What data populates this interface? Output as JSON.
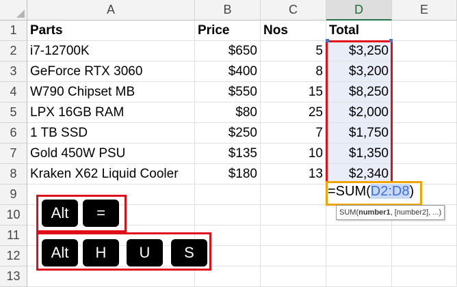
{
  "columns": [
    "A",
    "B",
    "C",
    "D",
    "E"
  ],
  "rows": [
    "1",
    "2",
    "3",
    "4",
    "5",
    "6",
    "7",
    "8",
    "9",
    "10",
    "11",
    "12",
    "13"
  ],
  "headers": {
    "parts": "Parts",
    "price": "Price",
    "nos": "Nos",
    "total": "Total"
  },
  "table": [
    {
      "part": "i7-12700K",
      "price": "$650",
      "nos": "5",
      "total": "$3,250"
    },
    {
      "part": "GeForce RTX 3060",
      "price": "$400",
      "nos": "8",
      "total": "$3,200"
    },
    {
      "part": "W790 Chipset MB",
      "price": "$550",
      "nos": "15",
      "total": "$8,250"
    },
    {
      "part": "LPX 16GB RAM",
      "price": "$80",
      "nos": "25",
      "total": "$2,000"
    },
    {
      "part": "1 TB SSD",
      "price": "$250",
      "nos": "7",
      "total": "$1,750"
    },
    {
      "part": "Gold 450W PSU",
      "price": "$135",
      "nos": "10",
      "total": "$1,350"
    },
    {
      "part": "Kraken X62 Liquid Cooler",
      "price": "$180",
      "nos": "13",
      "total": "$2,340"
    }
  ],
  "formula": {
    "prefix": "=SUM(",
    "range": "D2:D8",
    "suffix": ")"
  },
  "tooltip": {
    "fn": "SUM(",
    "arg1": "number1",
    "rest": ", [number2], ...)"
  },
  "shortcut1": [
    "Alt",
    "="
  ],
  "shortcut2": [
    "Alt",
    "H",
    "U",
    "S"
  ],
  "colors": {
    "highlight_box": "#e0101a",
    "formula_box": "#f1a400",
    "selection": "#e8edf7",
    "range_ref": "#3a6ed8"
  }
}
